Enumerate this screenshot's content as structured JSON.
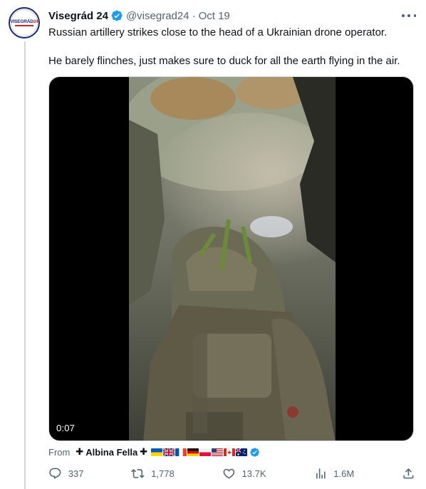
{
  "author": {
    "display_name": "Visegrád 24",
    "handle": "@visegrad24",
    "separator": "·",
    "time": "Oct 19",
    "avatar_logo": "VISEGRÁD",
    "avatar_logo_num": "24"
  },
  "tweet": {
    "line1": "Russian artillery strikes close to the head of a Ukrainian drone operator.",
    "line2": "He barely flinches, just makes sure to duck for all the earth flying in the air."
  },
  "media": {
    "duration": "0:07"
  },
  "source": {
    "from_label": "From",
    "cross": "✚",
    "name": "Albina Fella",
    "flags": [
      "ukraine",
      "united-kingdom",
      "france",
      "germany",
      "poland",
      "united-states",
      "canada",
      "australia"
    ]
  },
  "actions": {
    "replies": "337",
    "reposts": "1,778",
    "likes": "13.7K",
    "views": "1.6M"
  },
  "icons": {
    "verified": "verified-badge-icon",
    "more": "more-icon",
    "reply": "reply-icon",
    "repost": "repost-icon",
    "like": "heart-icon",
    "views": "analytics-icon",
    "share": "share-icon"
  },
  "colors": {
    "verified": "#1d9bf0",
    "muted": "#536471",
    "text": "#0f1419",
    "border": "#cfd9de"
  }
}
